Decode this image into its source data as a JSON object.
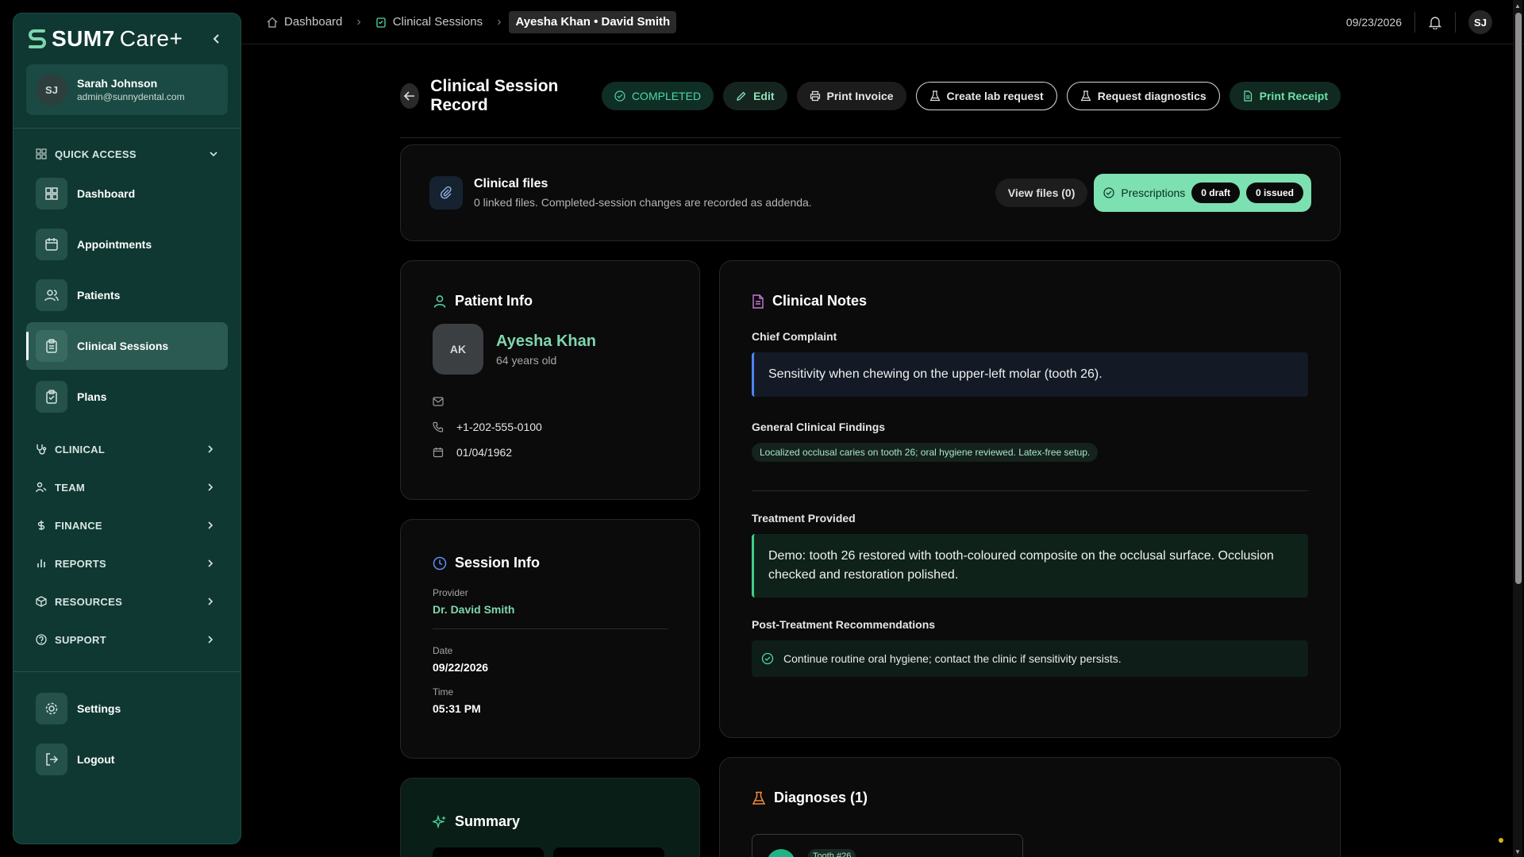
{
  "brand": {
    "name": "SUM7",
    "suffix": "Care+"
  },
  "user": {
    "initials": "SJ",
    "name": "Sarah Johnson",
    "email": "admin@sunnydental.com"
  },
  "sidebar": {
    "quick_access_label": "QUICK ACCESS",
    "items": [
      {
        "label": "Dashboard",
        "icon": "grid-icon"
      },
      {
        "label": "Appointments",
        "icon": "calendar-icon"
      },
      {
        "label": "Patients",
        "icon": "users-icon"
      },
      {
        "label": "Clinical Sessions",
        "icon": "clipboard-icon",
        "active": true
      },
      {
        "label": "Plans",
        "icon": "clipboard-check-icon"
      }
    ],
    "groups": [
      {
        "label": "CLINICAL",
        "icon": "stethoscope-icon"
      },
      {
        "label": "TEAM",
        "icon": "team-icon"
      },
      {
        "label": "FINANCE",
        "icon": "dollar-icon"
      },
      {
        "label": "REPORTS",
        "icon": "bar-chart-icon"
      },
      {
        "label": "RESOURCES",
        "icon": "box-icon"
      },
      {
        "label": "SUPPORT",
        "icon": "help-icon"
      }
    ],
    "settings_label": "Settings",
    "logout_label": "Logout"
  },
  "breadcrumb": {
    "items": [
      "Dashboard",
      "Clinical Sessions"
    ],
    "current": "Ayesha Khan • David Smith"
  },
  "topbar": {
    "date": "09/23/2026",
    "avatar": "SJ"
  },
  "header": {
    "title": "Clinical Session Record",
    "status": "COMPLETED",
    "edit": "Edit",
    "print_invoice": "Print Invoice",
    "create_lab": "Create lab request",
    "request_diag": "Request diagnostics",
    "print_receipt": "Print Receipt"
  },
  "files": {
    "title": "Clinical files",
    "subtitle": "0 linked files. Completed-session changes are recorded as addenda.",
    "view_files": "View files (0)",
    "prescriptions": "Prescriptions",
    "draft": "0 draft",
    "issued": "0 issued"
  },
  "patient": {
    "section_title": "Patient Info",
    "initials": "AK",
    "name": "Ayesha Khan",
    "age": "64 years old",
    "email": "",
    "phone": "+1-202-555-0100",
    "dob": "01/04/1962"
  },
  "session": {
    "section_title": "Session Info",
    "provider_label": "Provider",
    "provider": "Dr. David Smith",
    "date_label": "Date",
    "date": "09/22/2026",
    "time_label": "Time",
    "time": "05:31 PM"
  },
  "summary": {
    "title": "Summary"
  },
  "notes": {
    "title": "Clinical Notes",
    "complaint_label": "Chief Complaint",
    "complaint": "Sensitivity when chewing on the upper-left molar (tooth 26).",
    "findings_label": "General Clinical Findings",
    "findings": "Localized occlusal caries on tooth 26; oral hygiene reviewed. Latex-free setup.",
    "treatment_label": "Treatment Provided",
    "treatment": "Demo: tooth 26 restored with tooth-coloured composite on the occlusal surface. Occlusion checked and restoration polished.",
    "rec_label": "Post-Treatment Recommendations",
    "rec": "Continue routine oral hygiene; contact the clinic if sensitivity persists."
  },
  "diagnoses": {
    "title": "Diagnoses (1)",
    "tooth_tag": "Tooth #26"
  },
  "colors": {
    "sidebar_bg": "#0f3832",
    "accent_green": "#7ed6ae",
    "complaint_border": "#4d86f0",
    "treatment_border": "#3fcf8a"
  }
}
